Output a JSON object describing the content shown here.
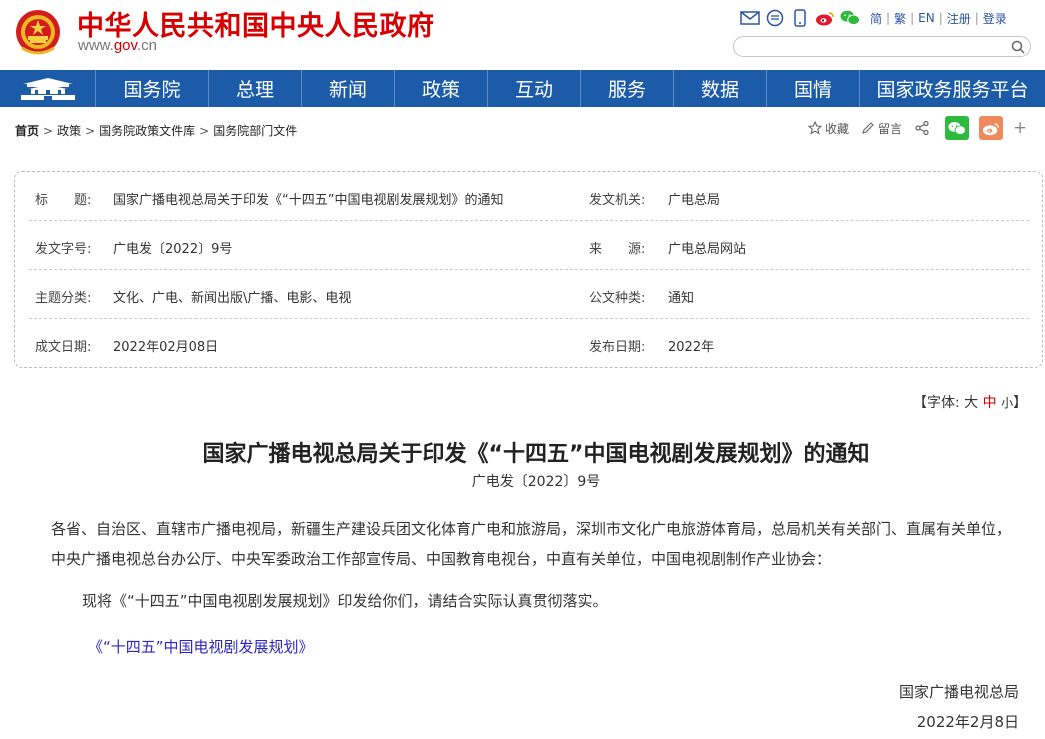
{
  "header": {
    "site_title": "中华人民共和国中央人民政府",
    "site_url_prefix": "www.",
    "site_url_gov": "gov",
    "site_url_suffix": ".cn",
    "tool_icons": [
      "mail-icon",
      "chat-icon",
      "mobile-icon",
      "weibo-icon",
      "wechat-icon"
    ],
    "lang": {
      "simplified": "简",
      "traditional": "繁",
      "english": "EN",
      "register": "注册",
      "login": "登录"
    },
    "search_placeholder": ""
  },
  "nav": {
    "items": [
      "国务院",
      "总理",
      "新闻",
      "政策",
      "互动",
      "服务",
      "数据",
      "国情",
      "国家政务服务平台"
    ]
  },
  "breadcrumb": {
    "items": [
      "首页",
      "政策",
      "国务院政策文件库",
      "国务院部门文件"
    ],
    "separator": ">"
  },
  "actions": {
    "favorite": "收藏",
    "comment": "留言"
  },
  "info": {
    "title_label": "标　　题:",
    "title_value": "国家广播电视总局关于印发《“十四五”中国电视剧发展规划》的通知",
    "issuer_label": "发文机关:",
    "issuer_value": "广电总局",
    "docno_label": "发文字号:",
    "docno_value": "广电发〔2022〕9号",
    "source_label": "来　　源:",
    "source_value": "广电总局网站",
    "topic_label": "主题分类:",
    "topic_value": "文化、广电、新闻出版\\广播、电影、电视",
    "type_label": "公文种类:",
    "type_value": "通知",
    "written_label": "成文日期:",
    "written_value": "2022年02月08日",
    "published_label": "发布日期:",
    "published_value": "2022年"
  },
  "font_switch": {
    "open": "【字体:",
    "large": "大",
    "medium": "中",
    "small": "小",
    "close": "】"
  },
  "article": {
    "title": "国家广播电视总局关于印发《“十四五”中国电视剧发展规划》的通知",
    "doc_no": "广电发〔2022〕9号",
    "recipients": "各省、自治区、直辖市广播电视局，新疆生产建设兵团文化体育广电和旅游局，深圳市文化广电旅游体育局，总局机关有关部门、直属有关单位，中央广播电视总台办公厅、中央军委政治工作部宣传局、中国教育电视台，中直有关单位，中国电视剧制作产业协会：",
    "body": "现将《“十四五”中国电视剧发展规划》印发给你们，请结合实际认真贯彻落实。",
    "attachment": "《“十四五”中国电视剧发展规划》",
    "signer": "国家广播电视总局",
    "date": "2022年2月8日"
  },
  "colors": {
    "brand_red": "#d60000",
    "nav_blue": "#1c5ba8",
    "link_blue": "#2b25c4",
    "wechat_green": "#2dbb3d",
    "weibo_orange": "#f08a5d"
  }
}
